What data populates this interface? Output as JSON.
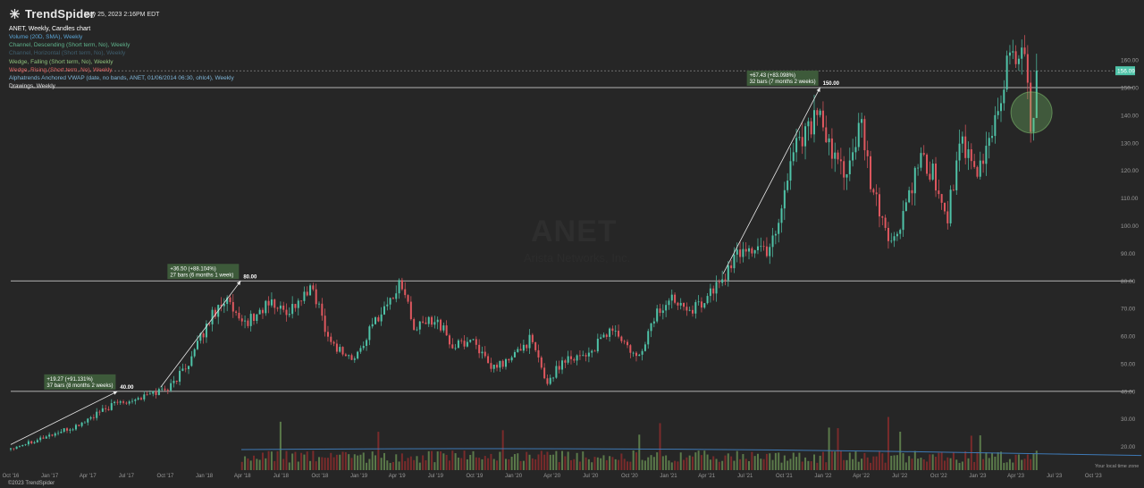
{
  "header": {
    "brand": "TrendSpider",
    "timestamp": "May 25, 2023 2:16PM EDT",
    "chart_title": "ANET, Weekly, Candles chart"
  },
  "indicators": [
    {
      "label": "Volume (20D, SMA), Weekly",
      "color": "#5aa5d6"
    },
    {
      "label": "Channel, Descending (Short term, No), Weekly",
      "color": "#5fb38c"
    },
    {
      "label": "Channel, Horizontal (Short term, No), Weekly",
      "color": "#3f5e6e"
    },
    {
      "label": "Wedge, Falling (Short term, No), Weekly",
      "color": "#8fc07b"
    },
    {
      "label": "Wedge, Rising (Short term, No), Weekly",
      "color": "#e26464"
    },
    {
      "label": "Alphatrends Anchored VWAP (date, no bands, ANET, 01/06/2014 06:30, ohlc4), Weekly",
      "color": "#7fb6d9"
    },
    {
      "label": "Drawings, Weekly",
      "color": "#e4e4e4"
    }
  ],
  "watermark": {
    "symbol": "ANET",
    "subtitle": "Arista Networks, Inc."
  },
  "footer": {
    "copyright": "©2023 TrendSpider",
    "timezone": "Your local time zone"
  },
  "colors": {
    "background": "#262626",
    "up": "#4fc3a8",
    "down": "#e0585f",
    "vol_up": "#5b7a4a",
    "vol_down": "#7a2b2b",
    "vol_ma": "#3e79b5",
    "price_tag": "#4fc3a8"
  },
  "chart_data": {
    "type": "candlestick",
    "symbol": "ANET",
    "timeframe": "Weekly",
    "x_range": [
      "2016-10-01",
      "2023-11-01"
    ],
    "y_range": [
      16,
      172
    ],
    "y_ticks": [
      20,
      30,
      40,
      50,
      60,
      70,
      80,
      90,
      100,
      110,
      120,
      130,
      140,
      150,
      160
    ],
    "x_ticks": [
      {
        "label": "Oct '16",
        "date": "2016-10-01"
      },
      {
        "label": "Jan '17",
        "date": "2017-01-01"
      },
      {
        "label": "Apr '17",
        "date": "2017-04-01"
      },
      {
        "label": "Jul '17",
        "date": "2017-07-01"
      },
      {
        "label": "Oct '17",
        "date": "2017-10-01"
      },
      {
        "label": "Jan '18",
        "date": "2018-01-01"
      },
      {
        "label": "Apr '18",
        "date": "2018-04-01"
      },
      {
        "label": "Jul '18",
        "date": "2018-07-01"
      },
      {
        "label": "Oct '18",
        "date": "2018-10-01"
      },
      {
        "label": "Jan '19",
        "date": "2019-01-01"
      },
      {
        "label": "Apr '19",
        "date": "2019-04-01"
      },
      {
        "label": "Jul '19",
        "date": "2019-07-01"
      },
      {
        "label": "Oct '19",
        "date": "2019-10-01"
      },
      {
        "label": "Jan '20",
        "date": "2020-01-01"
      },
      {
        "label": "Apr '20",
        "date": "2020-04-01"
      },
      {
        "label": "Jul '20",
        "date": "2020-07-01"
      },
      {
        "label": "Oct '20",
        "date": "2020-10-01"
      },
      {
        "label": "Jan '21",
        "date": "2021-01-01"
      },
      {
        "label": "Apr '21",
        "date": "2021-04-01"
      },
      {
        "label": "Jul '21",
        "date": "2021-07-01"
      },
      {
        "label": "Oct '21",
        "date": "2021-10-01"
      },
      {
        "label": "Jan '22",
        "date": "2022-01-01"
      },
      {
        "label": "Apr '22",
        "date": "2022-04-01"
      },
      {
        "label": "Jul '22",
        "date": "2022-07-01"
      },
      {
        "label": "Oct '22",
        "date": "2022-10-01"
      },
      {
        "label": "Jan '23",
        "date": "2023-01-01"
      },
      {
        "label": "Apr '23",
        "date": "2023-04-01"
      },
      {
        "label": "Jul '23",
        "date": "2023-07-01"
      },
      {
        "label": "Oct '23",
        "date": "2023-10-01"
      }
    ],
    "close_path": [
      {
        "date": "2016-10-01",
        "close": 19.5
      },
      {
        "date": "2017-03-01",
        "close": 27
      },
      {
        "date": "2017-06-10",
        "close": 36
      },
      {
        "date": "2017-08-10",
        "close": 38
      },
      {
        "date": "2017-10-15",
        "close": 42
      },
      {
        "date": "2017-12-01",
        "close": 52
      },
      {
        "date": "2018-01-20",
        "close": 68
      },
      {
        "date": "2018-02-20",
        "close": 74
      },
      {
        "date": "2018-03-25",
        "close": 64
      },
      {
        "date": "2018-05-01",
        "close": 67
      },
      {
        "date": "2018-06-01",
        "close": 72
      },
      {
        "date": "2018-07-15",
        "close": 69
      },
      {
        "date": "2018-09-15",
        "close": 77
      },
      {
        "date": "2018-10-25",
        "close": 58
      },
      {
        "date": "2018-12-20",
        "close": 51
      },
      {
        "date": "2019-02-10",
        "close": 66
      },
      {
        "date": "2019-04-15",
        "close": 80
      },
      {
        "date": "2019-05-10",
        "close": 62
      },
      {
        "date": "2019-07-01",
        "close": 67
      },
      {
        "date": "2019-08-10",
        "close": 56
      },
      {
        "date": "2019-09-30",
        "close": 59
      },
      {
        "date": "2019-11-05",
        "close": 48
      },
      {
        "date": "2019-12-20",
        "close": 51
      },
      {
        "date": "2020-02-10",
        "close": 59
      },
      {
        "date": "2020-03-20",
        "close": 43
      },
      {
        "date": "2020-05-01",
        "close": 52
      },
      {
        "date": "2020-07-01",
        "close": 54
      },
      {
        "date": "2020-08-20",
        "close": 63
      },
      {
        "date": "2020-10-20",
        "close": 51
      },
      {
        "date": "2020-12-01",
        "close": 68
      },
      {
        "date": "2021-01-15",
        "close": 74
      },
      {
        "date": "2021-03-05",
        "close": 70
      },
      {
        "date": "2021-05-01",
        "close": 79
      },
      {
        "date": "2021-06-25",
        "close": 92
      },
      {
        "date": "2021-08-20",
        "close": 91
      },
      {
        "date": "2021-09-15",
        "close": 100
      },
      {
        "date": "2021-10-25",
        "close": 130
      },
      {
        "date": "2021-12-20",
        "close": 140
      },
      {
        "date": "2022-01-20",
        "close": 125
      },
      {
        "date": "2022-03-01",
        "close": 120
      },
      {
        "date": "2022-04-01",
        "close": 136
      },
      {
        "date": "2022-04-25",
        "close": 113
      },
      {
        "date": "2022-06-15",
        "close": 92
      },
      {
        "date": "2022-07-25",
        "close": 112
      },
      {
        "date": "2022-08-20",
        "close": 123
      },
      {
        "date": "2022-09-20",
        "close": 118
      },
      {
        "date": "2022-10-20",
        "close": 102
      },
      {
        "date": "2022-11-20",
        "close": 130
      },
      {
        "date": "2022-12-30",
        "close": 117
      },
      {
        "date": "2023-02-15",
        "close": 140
      },
      {
        "date": "2023-03-20",
        "close": 165
      },
      {
        "date": "2023-04-25",
        "close": 158
      },
      {
        "date": "2023-05-08",
        "close": 135
      },
      {
        "date": "2023-05-25",
        "close": 156.09
      }
    ],
    "horizontal_lines": [
      {
        "level": 40,
        "label": "40.00"
      },
      {
        "level": 80,
        "label": "80.00"
      },
      {
        "level": 150,
        "label": "150.00"
      }
    ],
    "measurements": [
      {
        "from_date": "2016-10-01",
        "from_price": 20.73,
        "to_date": "2017-06-10",
        "to_price": 40,
        "line1": "+19.27 (+91.131%)",
        "line2": "37 bars (8 months 2 weeks)",
        "target_label": "40.00"
      },
      {
        "from_date": "2017-09-20",
        "from_price": 41.5,
        "to_date": "2018-03-28",
        "to_price": 80,
        "line1": "+36.50 (+88.104%)",
        "line2": "27 bars (6 months 1 week)",
        "target_label": "80.00"
      },
      {
        "from_date": "2021-05-10",
        "from_price": 82.57,
        "to_date": "2021-12-25",
        "to_price": 150,
        "line1": "+67.43 (+83.098%)",
        "line2": "32 bars (7 months 2 weeks)",
        "target_label": "150.00"
      }
    ],
    "last_price": {
      "value": 156.09,
      "label": "156.09"
    },
    "highlight": {
      "date": "2023-05-08",
      "price": 140
    },
    "volume": {
      "visible": true,
      "sma_label": "Volume (20D, SMA), Weekly"
    }
  }
}
